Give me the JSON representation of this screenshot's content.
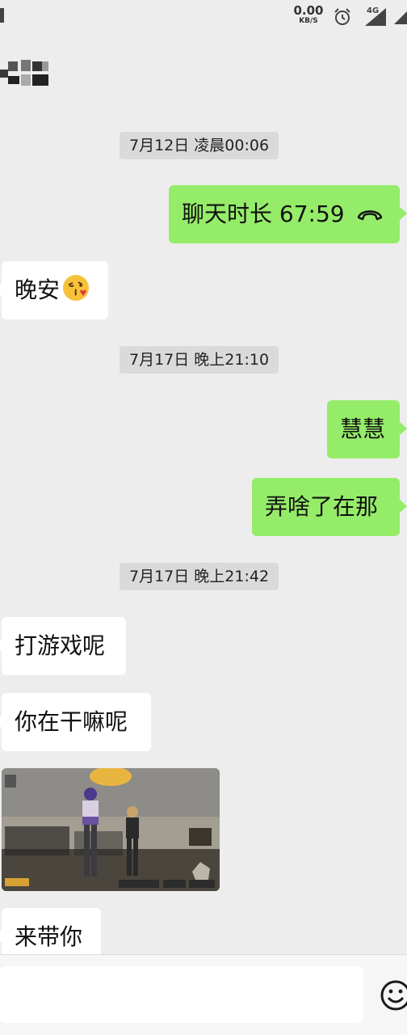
{
  "status_bar": {
    "net_speed": "0.00",
    "net_unit": "KB/S",
    "network_type": "4G",
    "icons": [
      "alarm-clock-icon",
      "signal-icon"
    ]
  },
  "header": {
    "contact_name_pixelated": true
  },
  "messages": [
    {
      "type": "timestamp",
      "text": "7月12日 凌晨00:06"
    },
    {
      "type": "outgoing-call",
      "text": "聊天时长 67:59",
      "icon": "hangup-icon"
    },
    {
      "type": "incoming",
      "text": "晚安",
      "emoji": "kissing-heart-emoji"
    },
    {
      "type": "timestamp",
      "text": "7月17日 晚上21:10"
    },
    {
      "type": "outgoing",
      "text": "慧慧"
    },
    {
      "type": "outgoing",
      "text": "弄啥了在那"
    },
    {
      "type": "timestamp",
      "text": "7月17日 晚上21:42"
    },
    {
      "type": "incoming",
      "text": "打游戏呢"
    },
    {
      "type": "incoming",
      "text": "你在干嘛呢"
    },
    {
      "type": "incoming-image",
      "description_icon": "game-screenshot"
    },
    {
      "type": "incoming",
      "text": "来带你"
    }
  ],
  "input_bar": {
    "placeholder": "",
    "icons": [
      "emoji-icon"
    ]
  },
  "colors": {
    "background": "#ededed",
    "outgoing_bubble": "#95ec69",
    "incoming_bubble": "#ffffff",
    "timestamp_bg": "#dadada"
  }
}
